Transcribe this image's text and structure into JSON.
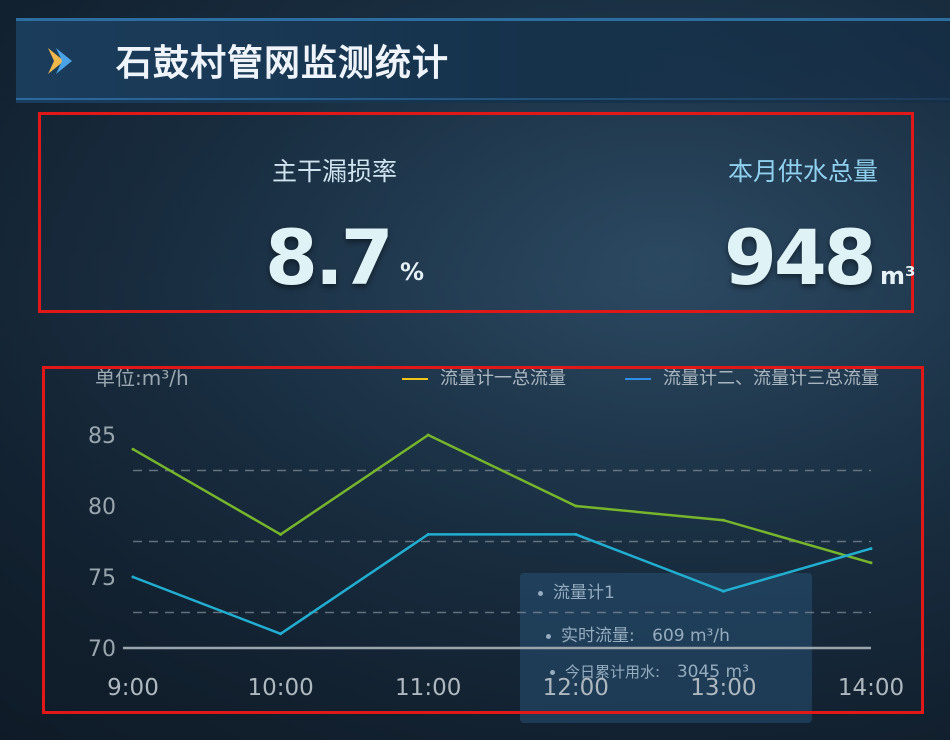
{
  "header": {
    "title": "石鼓村管网监测统计",
    "icon": "chevron-right-icon"
  },
  "stats": {
    "leak_rate_label": "主干漏损率",
    "leak_rate_value": "8.7",
    "leak_rate_unit": "%",
    "supply_label": "本月供水总量",
    "supply_value": "948",
    "supply_unit": "m³"
  },
  "chart_unit_label": "单位:m³/h",
  "tooltip": {
    "title": "流量计1",
    "realtime_label": "实时流量:",
    "realtime_value": "609 m³/h",
    "today_label": "今日累计用水:",
    "today_value": "3045 m³"
  },
  "colors": {
    "series1_legend": "#f2c618",
    "series2_legend": "#2f8fe8",
    "series1_line": "#76b52c",
    "series2_line": "#22aed0",
    "highlight_box": "#e01818"
  },
  "chart_data": {
    "type": "line",
    "categories": [
      "9:00",
      "10:00",
      "11:00",
      "12:00",
      "13:00",
      "14:00"
    ],
    "series": [
      {
        "name": "流量计一总流量",
        "values": [
          84,
          78,
          85,
          80,
          79,
          76
        ]
      },
      {
        "name": "流量计二、流量计三总流量",
        "values": [
          75,
          71,
          78,
          78,
          74,
          77
        ]
      }
    ],
    "ylim": [
      70,
      86
    ],
    "yticks": [
      70,
      75,
      80,
      85
    ],
    "ylabel": "单位:m³/h",
    "grid": "dashed horizontal",
    "legend": "top-right"
  }
}
